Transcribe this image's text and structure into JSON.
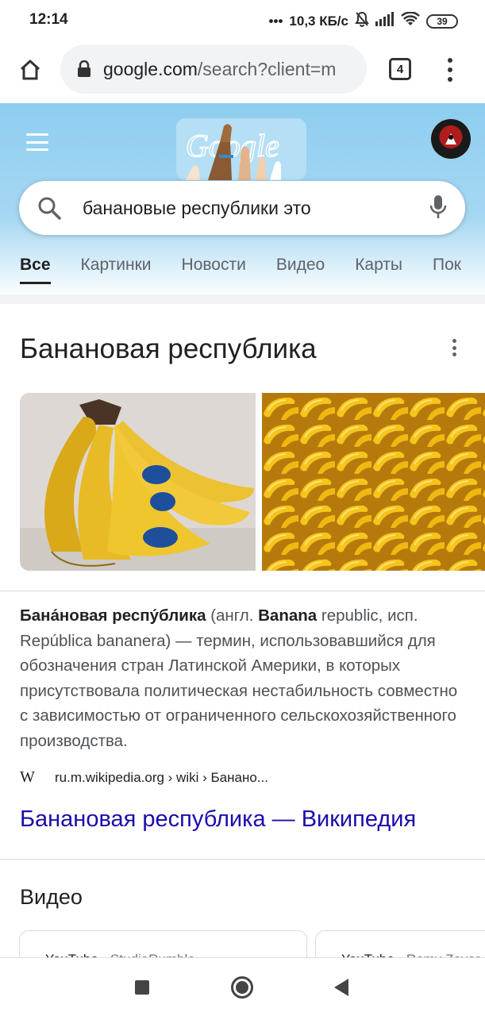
{
  "status_bar": {
    "time": "12:14",
    "network_speed": "10,3 КБ/с",
    "battery": "39",
    "icons": [
      "dots-icon",
      "mute-bell-icon",
      "signal-icon",
      "wifi-icon",
      "battery-icon"
    ]
  },
  "browser": {
    "url_host": "google.com",
    "url_rest": "/search?client=m",
    "tab_count": "4"
  },
  "google": {
    "search_query": "банановые республики это",
    "tabs": [
      {
        "label": "Все",
        "active": true
      },
      {
        "label": "Картинки",
        "active": false
      },
      {
        "label": "Новости",
        "active": false
      },
      {
        "label": "Видео",
        "active": false
      },
      {
        "label": "Карты",
        "active": false
      },
      {
        "label": "Пок",
        "active": false
      }
    ]
  },
  "knowledge_panel": {
    "title": "Банановая республика",
    "description": {
      "bold1": "Бана́новая респу́блика",
      "text1": " (англ. ",
      "bold2": "Banana",
      "text2": " republic, исп. República bananera) — термин, использовавшийся для обозначения стран Латинской Америки, в которых присутствовала политическая нестабильность совместно с зависимостью от ограниченного сельскохозяйственного производства."
    },
    "source_icon": "W",
    "source_breadcrumb": "ru.m.wikipedia.org › wiki › Банано...",
    "link_title": "Банановая республика — Википедия"
  },
  "videos": {
    "heading": "Видео",
    "cards": [
      {
        "source": "YouTube",
        "channel": "StudioRumble"
      },
      {
        "source": "YouTube",
        "channel": "Remy Zever"
      }
    ]
  },
  "colors": {
    "link": "#1a0dab",
    "header_blue": "#8ecdf0",
    "banana_yellow": "#f2c21a"
  }
}
